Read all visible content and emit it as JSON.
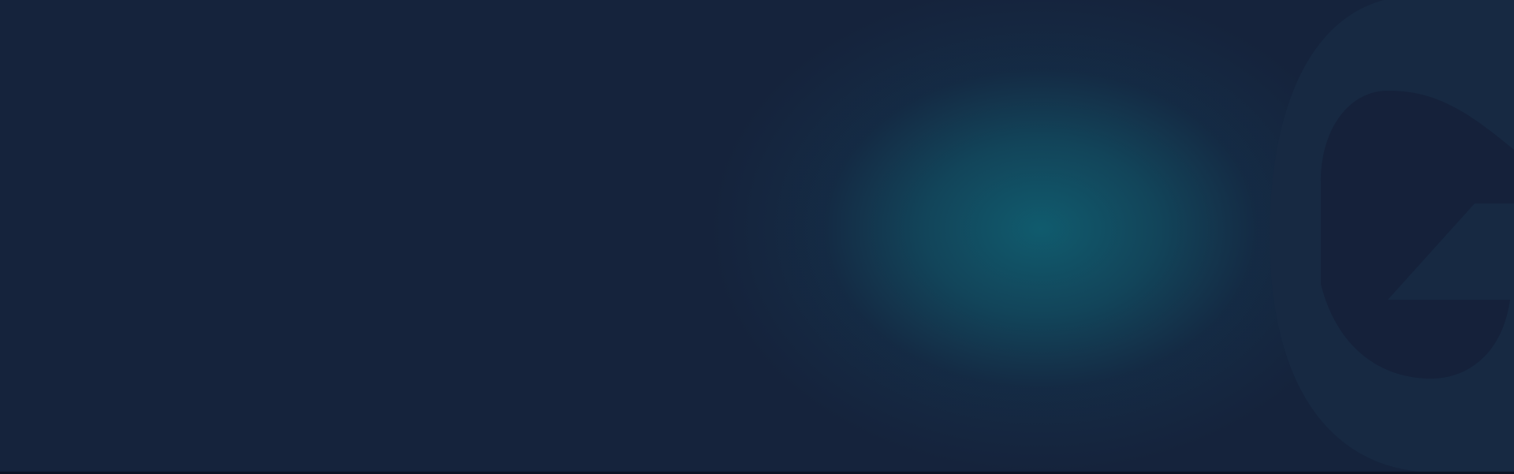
{
  "banner": {
    "background_color": "#15233c",
    "glow_color": "#105e70",
    "logo_icon": "partial-letter-g-icon"
  }
}
